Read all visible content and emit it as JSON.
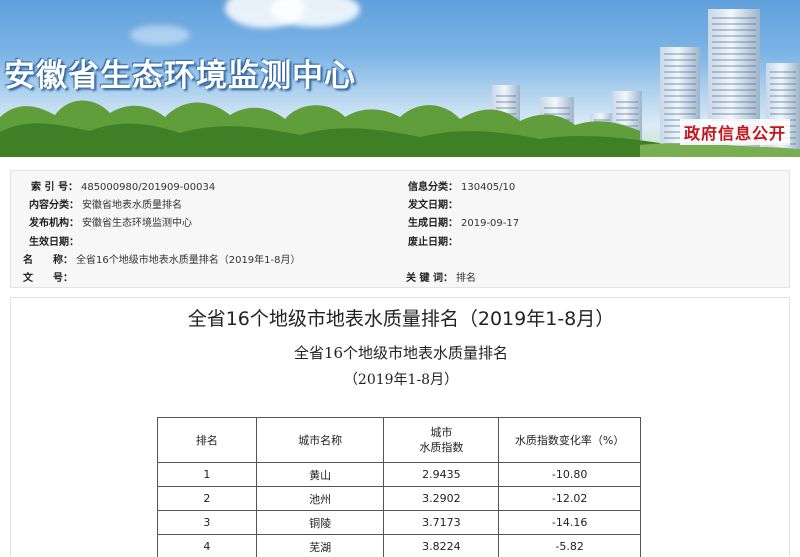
{
  "banner": {
    "site_name": "安徽省生态环境监测中心",
    "gov_info_label": "政府信息公开"
  },
  "meta": {
    "index_no": {
      "label": "索 引 号：",
      "value": "485000980/201909-00034"
    },
    "info_category": {
      "label": "信息分类：",
      "value": "130405/10"
    },
    "content_category": {
      "label": "内容分类：",
      "value": "安徽省地表水质量排名"
    },
    "publish_date": {
      "label": "发文日期：",
      "value": ""
    },
    "publisher": {
      "label": "发布机构：",
      "value": "安徽省生态环境监测中心"
    },
    "created_date": {
      "label": "生成日期：",
      "value": "2019-09-17"
    },
    "effective_date": {
      "label": "生效日期：",
      "value": ""
    },
    "repeal_date": {
      "label": "废止日期：",
      "value": ""
    },
    "name": {
      "label": "名　　称：",
      "value": "全省16个地级市地表水质量排名（2019年1-8月）"
    },
    "doc_no": {
      "label": "文　　号：",
      "value": ""
    },
    "keywords": {
      "label": "关 键 词：",
      "value": "排名"
    }
  },
  "article": {
    "title": "全省16个地级市地表水质量排名（2019年1-8月）",
    "subtitle_line1": "全省16个地级市地表水质量排名",
    "subtitle_line2": "（2019年1-8月）"
  },
  "table": {
    "headers": {
      "rank": "排名",
      "city": "城市名称",
      "index_line1": "城市",
      "index_line2": "水质指数",
      "change": "水质指数变化率（%）"
    },
    "rows": [
      {
        "rank": "1",
        "city": "黄山",
        "index": "2.9435",
        "change": "-10.80"
      },
      {
        "rank": "2",
        "city": "池州",
        "index": "3.2902",
        "change": "-12.02"
      },
      {
        "rank": "3",
        "city": "铜陵",
        "index": "3.7173",
        "change": "-14.16"
      },
      {
        "rank": "4",
        "city": "芜湖",
        "index": "3.8224",
        "change": "-5.82"
      }
    ]
  }
}
